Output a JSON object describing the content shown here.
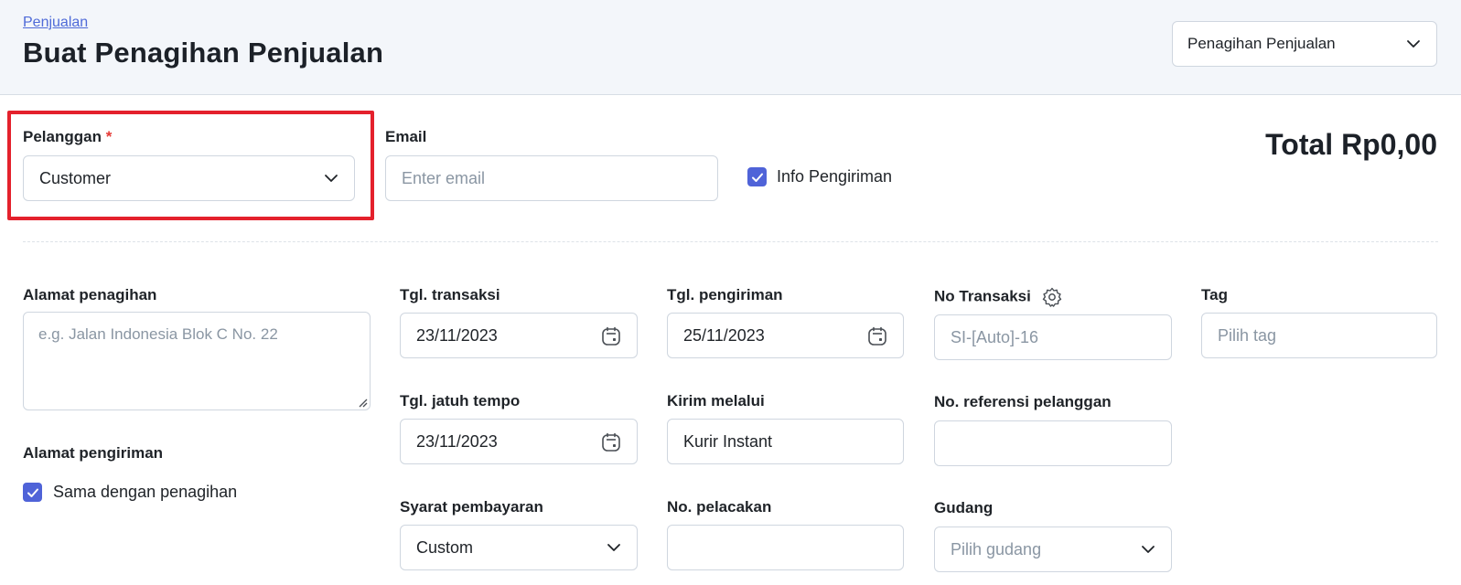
{
  "header": {
    "breadcrumb": "Penjualan",
    "title": "Buat Penagihan Penjualan",
    "type_select": "Penagihan Penjualan"
  },
  "customer": {
    "label": "Pelanggan",
    "required_mark": "*",
    "value": "Customer"
  },
  "email": {
    "label": "Email",
    "placeholder": "Enter email"
  },
  "shipping_info": {
    "label": "Info Pengiriman",
    "checked": true
  },
  "total": "Total Rp0,00",
  "billing_address": {
    "label": "Alamat penagihan",
    "placeholder": "e.g. Jalan Indonesia Blok C No. 22"
  },
  "shipping_address": {
    "label": "Alamat pengiriman",
    "same_label": "Sama dengan penagihan",
    "checked": true
  },
  "transaction_date": {
    "label": "Tgl. transaksi",
    "value": "23/11/2023"
  },
  "due_date": {
    "label": "Tgl. jatuh tempo",
    "value": "23/11/2023"
  },
  "payment_terms": {
    "label": "Syarat pembayaran",
    "value": "Custom"
  },
  "ship_date": {
    "label": "Tgl. pengiriman",
    "value": "25/11/2023"
  },
  "ship_via": {
    "label": "Kirim melalui",
    "value": "Kurir Instant"
  },
  "tracking_no": {
    "label": "No. pelacakan",
    "value": ""
  },
  "transaction_no": {
    "label": "No Transaksi",
    "placeholder": "SI-[Auto]-16"
  },
  "customer_ref": {
    "label": "No. referensi pelanggan",
    "value": ""
  },
  "warehouse": {
    "label": "Gudang",
    "placeholder": "Pilih gudang"
  },
  "tag": {
    "label": "Tag",
    "placeholder": "Pilih tag"
  },
  "colors": {
    "accent": "#4f63d8",
    "link": "#4f6bd8",
    "highlight": "#e4212c",
    "required": "#e53935",
    "header_bg": "#f3f6fa"
  }
}
